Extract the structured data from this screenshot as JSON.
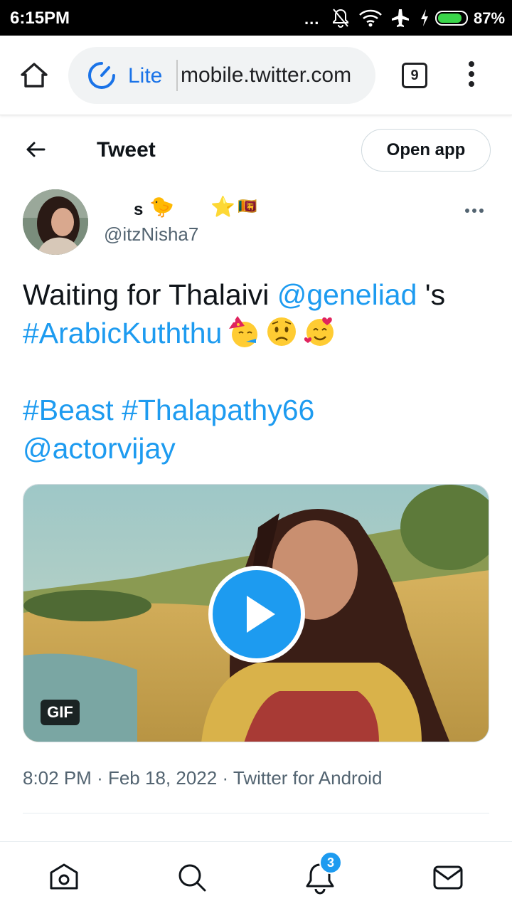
{
  "status_bar": {
    "time": "6:15PM",
    "dots": "...",
    "battery_percent": "87%",
    "battery_level": 0.87,
    "icons": [
      "bell-muted-icon",
      "wifi-icon",
      "airplane-icon",
      "charging-icon",
      "battery-icon"
    ]
  },
  "browser": {
    "mode_label": "Lite",
    "url": "mobile.twitter.com",
    "tab_count": "9",
    "accent": "#1a73e8"
  },
  "header": {
    "title": "Tweet",
    "open_app_label": "Open app"
  },
  "tweet": {
    "author": {
      "display_name": "s",
      "emojis": [
        "🐤",
        "⭐",
        "🇱🇰"
      ],
      "handle": "@itzNisha7"
    },
    "text": {
      "intro": "Waiting for Thalaivi ",
      "mention_1": "@geneliad",
      "possessive": " 's",
      "hashtag_1": "#ArabicKuththu",
      "hashtag_2": "#Beast",
      "hashtag_3": "#Thalapathy66",
      "mention_2": "@actorvijay",
      "reaction_emojis": [
        "partying-face",
        "worried-face",
        "smiling-face-with-hearts"
      ]
    },
    "media": {
      "badge": "GIF",
      "play_icon": "play-icon"
    },
    "meta": {
      "time": "8:02 PM",
      "separator": "·",
      "date": "Feb 18, 2022",
      "source": "Twitter for Android"
    },
    "link_color": "#1d9bf0"
  },
  "bottom_nav": {
    "items": [
      "home-icon",
      "search-icon",
      "notifications-icon",
      "messages-icon"
    ],
    "notification_count": "3"
  }
}
